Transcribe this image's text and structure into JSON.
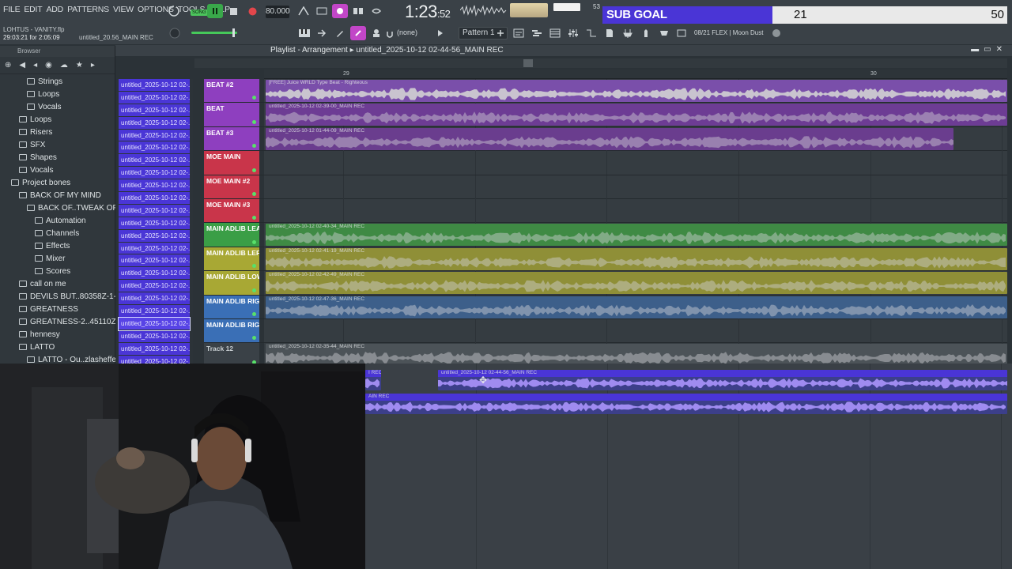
{
  "menu": [
    "FILE",
    "EDIT",
    "ADD",
    "PATTERNS",
    "VIEW",
    "OPTIONS",
    "TOOLS",
    "HELP"
  ],
  "project": {
    "name": "LOHTUS - VANITY.flp",
    "time_info": "29:03:21 for 2:05:09",
    "rec_name": "untitled_20.56_MAIN REC"
  },
  "transport": {
    "pat_song": "SONG",
    "tempo": "80.000",
    "time_main": "1:23",
    "time_sub": ":52",
    "cpu_num": "53"
  },
  "sub_goal": {
    "label": "SUB GOAL",
    "current": "21",
    "target": "50",
    "progress": 0.42,
    "fill_color": "#4a35d6"
  },
  "toolbar2": {
    "snap": "(none)",
    "pattern": "Pattern 1",
    "plugin": "08/21  FLEX | Moon Dust"
  },
  "browser": {
    "title": "Browser",
    "items": [
      {
        "label": "Strings",
        "indent": 3
      },
      {
        "label": "Loops",
        "indent": 3
      },
      {
        "label": "Vocals",
        "indent": 3
      },
      {
        "label": "Loops",
        "indent": 2
      },
      {
        "label": "Risers",
        "indent": 2
      },
      {
        "label": "SFX",
        "indent": 2
      },
      {
        "label": "Shapes",
        "indent": 2
      },
      {
        "label": "Vocals",
        "indent": 2
      },
      {
        "label": "Project bones",
        "indent": 1
      },
      {
        "label": "BACK OF MY MIND",
        "indent": 2
      },
      {
        "label": "BACK OF..TWEAK OPEN",
        "indent": 3
      },
      {
        "label": "Automation",
        "indent": 4
      },
      {
        "label": "Channels",
        "indent": 4
      },
      {
        "label": "Effects",
        "indent": 4
      },
      {
        "label": "Mixer",
        "indent": 4
      },
      {
        "label": "Scores",
        "indent": 4
      },
      {
        "label": "call on me",
        "indent": 2
      },
      {
        "label": "DEVILS BUT..80358Z-1-001",
        "indent": 2
      },
      {
        "label": "GREATNESS",
        "indent": 2
      },
      {
        "label": "GREATNESS-2..45110Z-001",
        "indent": 2
      },
      {
        "label": "hennesy",
        "indent": 2
      },
      {
        "label": "LATTO",
        "indent": 2
      },
      {
        "label": "LATTO - Ou..zlasheffect",
        "indent": 3
      }
    ]
  },
  "clip_list": {
    "item_label": "untitled_2025-10-12 02-...",
    "count": 23,
    "selected_index": 19
  },
  "playlist": {
    "title": "Playlist - Arrangement",
    "clip": "untitled_2025-10-12 02-44-56_MAIN REC",
    "ruler": [
      {
        "label": "29"
      },
      {
        "label": "30"
      }
    ],
    "tracks": [
      {
        "name": "BEAT #2",
        "color": "#8e3fbf",
        "clip": "[FREE] Juice WRLD Type Beat - Righteous",
        "clip_color": "#7a4faa"
      },
      {
        "name": "BEAT",
        "color": "#8e3fbf",
        "clip": "untitled_2025-10-12 02-39-00_MAIN REC",
        "clip_color": "#6d3c94"
      },
      {
        "name": "BEAT #3",
        "color": "#8e3fbf",
        "clip": "untitled_2025-10-12 01-44-09_MAIN REC",
        "clip_color": "#6a3d8e"
      },
      {
        "name": "MOE MAIN",
        "color": "#c9354a",
        "clip": "",
        "clip_color": ""
      },
      {
        "name": "MOE MAIN #2",
        "color": "#c9354a",
        "clip": "",
        "clip_color": ""
      },
      {
        "name": "MOE MAIN #3",
        "color": "#c9354a",
        "clip": "",
        "clip_color": ""
      },
      {
        "name": "MAIN ADLIB LEAD",
        "color": "#3a9e46",
        "clip": "untitled_2025-10-12 02-40-34_MAIN REC",
        "clip_color": "#3f8a44"
      },
      {
        "name": "MAIN ADLIB LEFT",
        "color": "#a8a834",
        "clip": "untitled_2025-10-12 02-41-19_MAIN REC",
        "clip_color": "#8f8f37"
      },
      {
        "name": "MAIN ADLIB LOWS L",
        "color": "#a8a834",
        "clip": "untitled_2025-10-12 02-42-49_MAIN REC",
        "clip_color": "#8f8f37"
      },
      {
        "name": "MAIN ADLIB RIGHT",
        "color": "#3a6fb6",
        "clip": "untitled_2025-10-12 02-47-36_MAIN REC",
        "clip_color": "#3d5f8a"
      },
      {
        "name": "MAIN ADLIB RIGHT",
        "color": "#3a6fb6",
        "clip": "",
        "clip_color": ""
      },
      {
        "name": "Track 12",
        "color": "#3a4147",
        "clip": "untitled_2025-10-12 02-35-44_MAIN REC",
        "clip_color": "#4c5358"
      }
    ]
  },
  "lower": {
    "clip_a_left": "I REC",
    "clip_a": "untitled_2025-10-12 02-44-56_MAIN REC",
    "clip_b": "AIN REC"
  }
}
